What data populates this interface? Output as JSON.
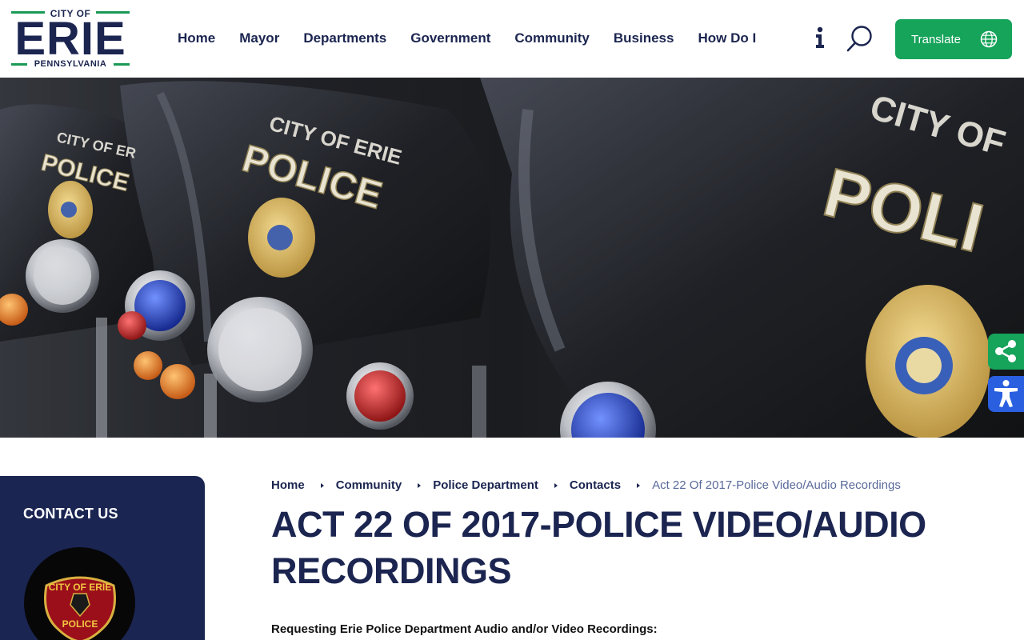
{
  "logo": {
    "top": "CITY OF",
    "main": "ERIE",
    "bottom": "PENNSYLVANIA"
  },
  "nav": {
    "items": [
      "Home",
      "Mayor",
      "Departments",
      "Government",
      "Community",
      "Business",
      "How Do I"
    ]
  },
  "header": {
    "translate_label": "Translate"
  },
  "hero": {
    "badge_text": "CITY OF ERIE",
    "fairing_text": "POLICE"
  },
  "sidebar": {
    "heading": "CONTACT US",
    "badge_top": "CITY OF ERIE",
    "badge_bottom": "POLICE"
  },
  "breadcrumb": {
    "items": [
      "Home",
      "Community",
      "Police Department",
      "Contacts"
    ],
    "current": "Act 22 Of 2017-Police Video/Audio Recordings"
  },
  "page": {
    "title": "ACT 22 OF 2017-POLICE VIDEO/AUDIO RECORDINGS",
    "intro": "Requesting Erie Police Department Audio and/or Video Recordings:"
  },
  "colors": {
    "navy": "#1b2550",
    "green": "#16a35a",
    "blue": "#2a5fe0"
  },
  "icons": [
    "info-icon",
    "search-icon",
    "globe-icon",
    "share-icon",
    "accessibility-icon"
  ]
}
